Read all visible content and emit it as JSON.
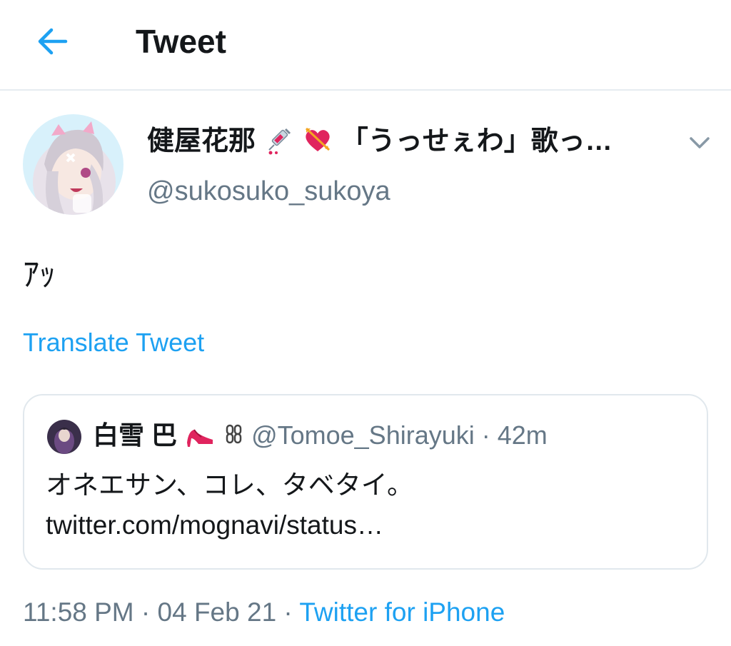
{
  "header": {
    "title": "Tweet",
    "back_icon": "arrow-left-icon",
    "accent": "#1da1f2"
  },
  "author": {
    "name_text": "健屋花那",
    "name_suffix": "「うっせぇわ」歌っ…",
    "handle": "@sukosuko_sukoya",
    "emojis": [
      "syringe-emoji-icon",
      "heart-with-arrow-emoji-icon"
    ],
    "menu_icon": "chevron-down-icon"
  },
  "tweet": {
    "text": "ｱｯ",
    "translate_label": "Translate Tweet"
  },
  "quote": {
    "name": "白雪 巴",
    "emojis": [
      "high-heel-emoji-icon",
      "chain-emoji-icon"
    ],
    "handle": "@Tomoe_Shirayuki",
    "separator": " · ",
    "time": "42m",
    "text": "オネエサン、コレ、タベタイ。",
    "link": "twitter.com/mognavi/status…"
  },
  "footer": {
    "time": "11:58 PM",
    "sep1": " · ",
    "date": "04 Feb 21",
    "sep2": " · ",
    "source": "Twitter for iPhone"
  },
  "colors": {
    "link": "#1da1f2",
    "secondary_text": "#657786",
    "border": "#e1e8ed",
    "heart": "#e0245e"
  }
}
